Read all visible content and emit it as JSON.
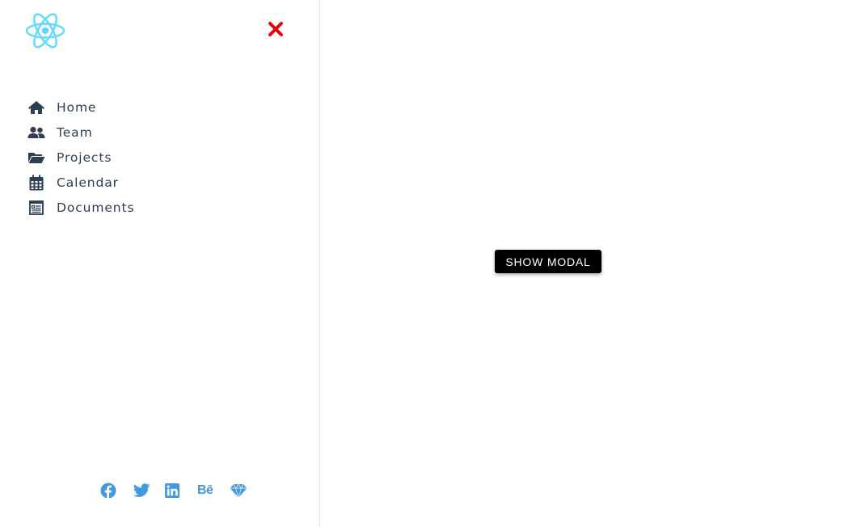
{
  "colors": {
    "nav_text": "#2f4056",
    "nav_icon": "#2d3e55",
    "social_icon": "#4299e1",
    "close_icon": "#e8000a",
    "logo": "#61dafb",
    "button_bg": "#000000",
    "button_text": "#ffffff"
  },
  "sidebar": {
    "logo_icon": "react-logo",
    "close_icon": "x-icon",
    "nav": [
      {
        "label": "Home",
        "icon": "home-icon"
      },
      {
        "label": "Team",
        "icon": "users-icon"
      },
      {
        "label": "Projects",
        "icon": "folder-open-icon"
      },
      {
        "label": "Calendar",
        "icon": "calendar-icon"
      },
      {
        "label": "Documents",
        "icon": "document-icon"
      }
    ],
    "social": [
      {
        "icon": "facebook-icon"
      },
      {
        "icon": "twitter-icon"
      },
      {
        "icon": "linkedin-icon"
      },
      {
        "icon": "behance-icon",
        "text": "Bē"
      },
      {
        "icon": "sketch-icon"
      }
    ]
  },
  "main": {
    "show_modal_label": "SHOW MODAL"
  }
}
